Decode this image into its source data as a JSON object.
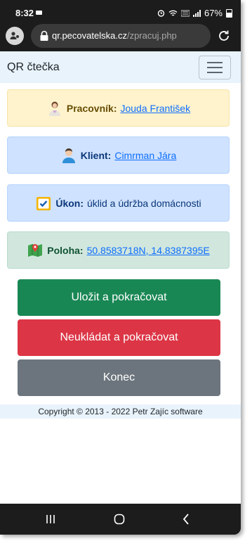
{
  "status_bar": {
    "time": "8:32",
    "right_text": "67%",
    "icons": [
      "camera-icon",
      "alarm-icon",
      "wifi-icon",
      "volte-icon",
      "signal-icon",
      "battery-icon"
    ]
  },
  "browser": {
    "url_domain": "qr.pecovatelska.cz",
    "url_path": "/zpracuj.php"
  },
  "navbar": {
    "brand": "QR čtečka"
  },
  "alerts": {
    "worker": {
      "label": "Pracovník:",
      "value": "Jouda František"
    },
    "client": {
      "label": "Klient:",
      "value": "Cimrman Jára"
    },
    "task": {
      "label": "Úkon:",
      "value": "úklid a údržba domácnosti"
    },
    "location": {
      "label": "Poloha:",
      "value": "50.8583718N, 14.8387395E"
    }
  },
  "buttons": {
    "save": "Uložit a pokračovat",
    "discard": "Neukládat a pokračovat",
    "end": "Konec"
  },
  "footer": {
    "text": "Copyright © 2013 - 2022 Petr Zajíc software"
  },
  "colors": {
    "success": "#198754",
    "danger": "#dc3545",
    "secondary": "#6c757d",
    "navbar_bg": "#e8f3fc"
  }
}
